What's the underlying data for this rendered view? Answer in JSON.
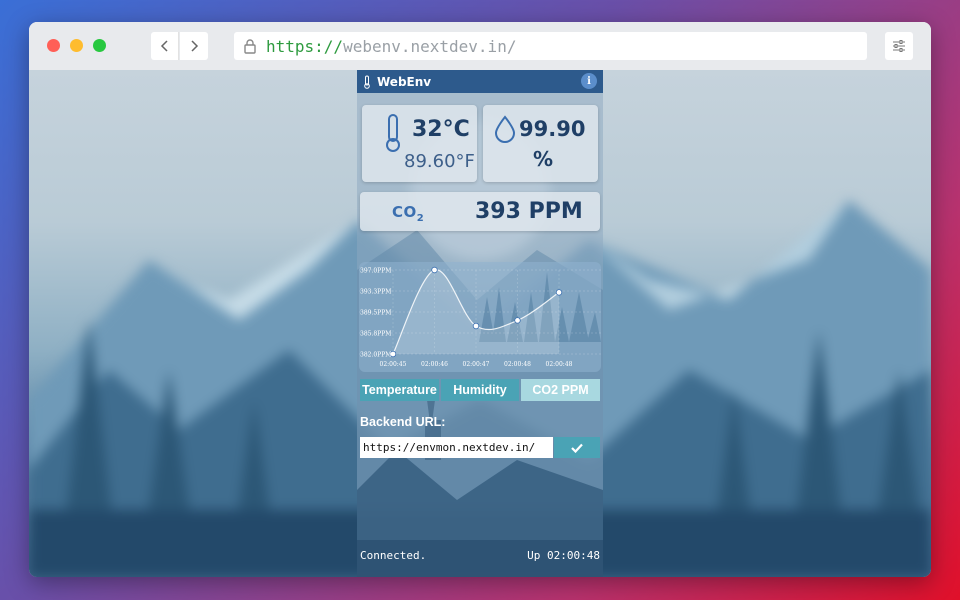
{
  "browser": {
    "url_scheme": "https://",
    "url_host": "webenv.nextdev.in/",
    "back_icon": "chevron-left-icon",
    "forward_icon": "chevron-right-icon",
    "settings_icon": "sliders-icon"
  },
  "app": {
    "brand": "WebEnv",
    "info_label": "i"
  },
  "readings": {
    "temp_c": "32°C",
    "temp_f": "89.60°F",
    "humidity": "99.90",
    "humidity_unit": "%",
    "co2_label": "CO",
    "co2_sub": "2",
    "co2_value": "393 PPM"
  },
  "tabs": {
    "temperature": "Temperature",
    "humidity": "Humidity",
    "co2": "CO2 PPM"
  },
  "backend": {
    "label": "Backend URL:",
    "value": "https://envmon.nextdev.in/"
  },
  "status": {
    "connection": "Connected.",
    "uptime": "Up 02:00:48"
  },
  "chart_data": {
    "type": "line",
    "x": [
      "02:00:45",
      "02:00:46",
      "02:00:47",
      "02:00:48",
      "02:00:48"
    ],
    "values": [
      382.0,
      397.0,
      387.0,
      388.0,
      393.0
    ],
    "y_ticks": [
      "397.0PPM",
      "393.3PPM",
      "389.5PPM",
      "385.8PPM",
      "382.0PPM"
    ],
    "ylim": [
      382.0,
      397.0
    ],
    "grid": true,
    "colors": {
      "line": "#ffffff",
      "fill": "rgba(255,255,255,0.18)"
    }
  }
}
